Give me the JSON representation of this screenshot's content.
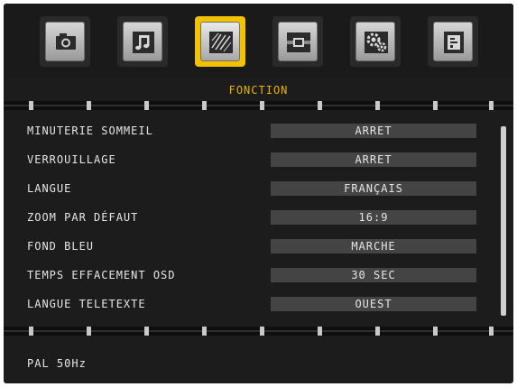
{
  "tabs": [
    {
      "icon": "picture-icon"
    },
    {
      "icon": "music-note-icon"
    },
    {
      "icon": "function-tools-icon",
      "active": true
    },
    {
      "icon": "cable-connector-icon"
    },
    {
      "icon": "settings-gears-icon"
    },
    {
      "icon": "source-input-icon"
    }
  ],
  "section_title": "FONCTION",
  "menu": [
    {
      "label": "MINUTERIE SOMMEIL",
      "value": "ARRET"
    },
    {
      "label": "VERROUILLAGE",
      "value": "ARRET"
    },
    {
      "label": "LANGUE",
      "value": "FRANÇAIS"
    },
    {
      "label": "ZOOM PAR DÉFAUT",
      "value": "16:9"
    },
    {
      "label": "FOND BLEU",
      "value": "MARCHE"
    },
    {
      "label": "TEMPS EFFACEMENT OSD",
      "value": "30 SEC"
    },
    {
      "label": "LANGUE TELETEXTE",
      "value": "OUEST"
    }
  ],
  "status": "PAL 50Hz",
  "colors": {
    "accent": "#f2c200",
    "background": "#1c1c1c",
    "value_box": "#444444",
    "text": "#e6e6e6"
  }
}
